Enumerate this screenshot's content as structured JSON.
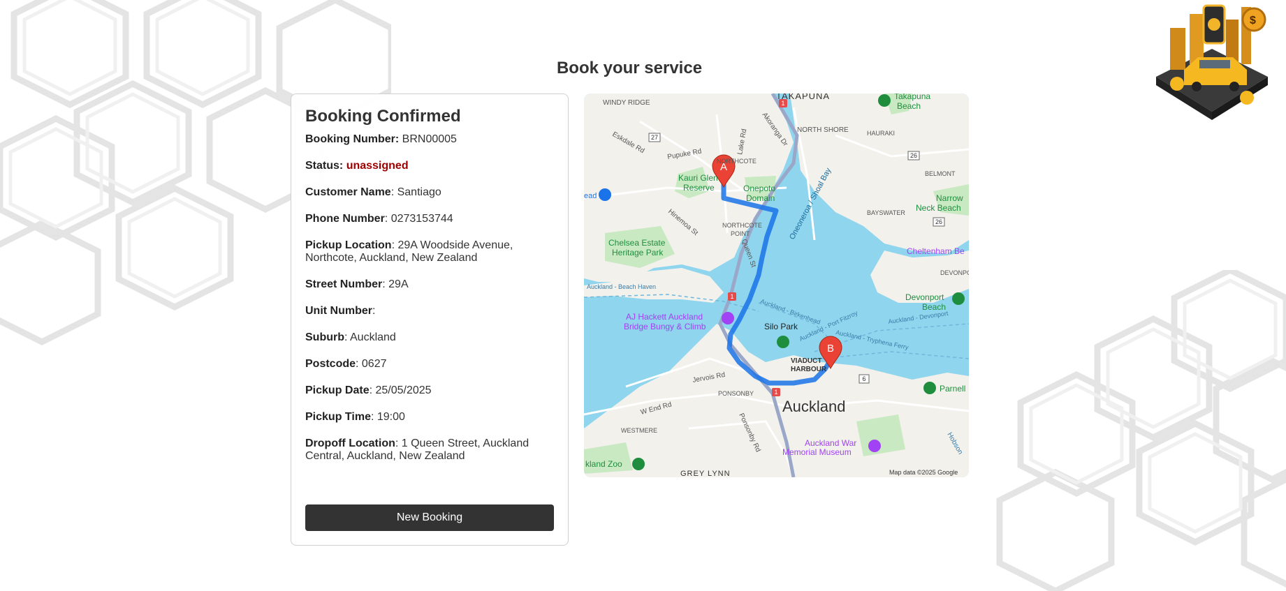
{
  "header": {
    "title": "Book your service"
  },
  "booking": {
    "heading": "Booking Confirmed",
    "number_label": "Booking Number:",
    "number": " BRN00005",
    "status_label": "Status:",
    "status": "unassigned",
    "name_label": "Customer Name",
    "name": ": Santiago",
    "phone_label": "Phone Number",
    "phone": ": 0273153744",
    "pickup_label": "Pickup Location",
    "pickup": ": 29A Woodside Avenue, Northcote, Auckland, New Zealand",
    "street_label": "Street Number",
    "street": ": 29A",
    "unit_label": "Unit Number",
    "unit": ":",
    "suburb_label": "Suburb",
    "suburb": ": Auckland",
    "postcode_label": "Postcode",
    "postcode": ": 0627",
    "date_label": "Pickup Date",
    "date": ": 25/05/2025",
    "time_label": "Pickup Time",
    "time": ": 19:00",
    "dropoff_label": "Dropoff Location",
    "dropoff": ": 1 Queen Street, Auckland Central, Auckland, New Zealand",
    "new_booking_button": "New Booking"
  },
  "map": {
    "marker_a": "A",
    "marker_b": "B",
    "labels": {
      "takapuna": "TAKAPUNA",
      "takapuna_beach_1": "Takapuna",
      "takapuna_beach_2": "Beach",
      "windy_ridge": "WINDY RIDGE",
      "north_shore": "NORTH SHORE",
      "hauraki": "HAURAKI",
      "northcote": "NORTHCOTE",
      "akoranga": "Akoranga Dr",
      "lake_rd": "Lake Rd",
      "eskdale": "Eskdale Rd",
      "pupuke": "Pupuke Rd",
      "belmont": "BELMONT",
      "kauri_1": "Kauri Glen",
      "kauri_2": "Reserve",
      "onepoto_1": "Onepoto",
      "onepoto_2": "Domain",
      "oneoneroa": "Oneoneroa / Shoal Bay",
      "narrow_1": "Narrow",
      "narrow_2": "Neck Beach",
      "bayswater": "BAYSWATER",
      "hinemoa": "Hinemoa St",
      "northcote_point_1": "NORTHCOTE",
      "northcote_point_2": "POINT",
      "chelsea_1": "Chelsea Estate",
      "chelsea_2": "Heritage Park",
      "queen_st": "Queen St",
      "cheltenham": "Cheltenham Be",
      "devonport": "DEVONPO",
      "devonport_beach_1": "Devonport",
      "devonport_beach_2": "Beach",
      "beach_haven": "Auckland - Beach Haven",
      "birkenhead": "Auckland - Birkenhead",
      "port_fitzroy": "Auckland - Port Fitzroy",
      "ak_devonport": "Auckland - Devonport",
      "tryphena": "Auckland - Tryphena Ferry",
      "aj_1": "AJ Hackett Auckland",
      "aj_2": "Bridge Bungy & Climb",
      "silo": "Silo Park",
      "viaduct_1": "VIADUCT",
      "viaduct_2": "HARBOUR",
      "jervois": "Jervois Rd",
      "ponsonby": "PONSONBY",
      "auckland": "Auckland",
      "parnell": "Parnell",
      "w_end": "W End Rd",
      "ponsonby_rd": "Ponsonby Rd",
      "westmere": "WESTMERE",
      "war_1": "Auckland War",
      "war_2": "Memorial Museum",
      "hobson": "Hobson",
      "zoo": "kland Zoo",
      "grey_lynn": "GREY LYNN",
      "road_ead": "ead",
      "copyright": "Map data ©2025 Google"
    },
    "shields": {
      "r26a": "26",
      "r26b": "26",
      "r27": "27",
      "r6": "6",
      "r1a": "1",
      "r1b": "1",
      "r1c": "1"
    }
  }
}
